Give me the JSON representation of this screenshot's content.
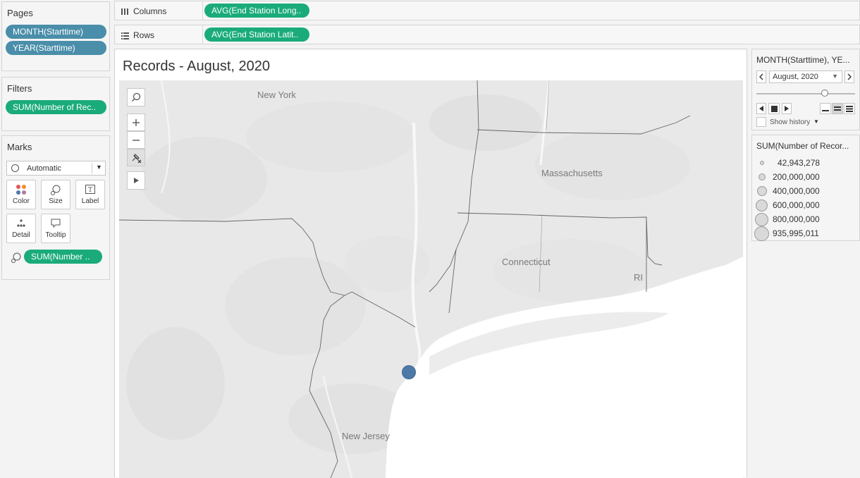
{
  "pages": {
    "title": "Pages",
    "pills": [
      "MONTH(Starttime)",
      "YEAR(Starttime)"
    ]
  },
  "filters": {
    "title": "Filters",
    "pills": [
      "SUM(Number of Rec.."
    ]
  },
  "marks": {
    "title": "Marks",
    "type": "Automatic",
    "buttons": {
      "color": "Color",
      "size": "Size",
      "label": "Label",
      "detail": "Detail",
      "tooltip": "Tooltip"
    },
    "size_pill": "SUM(Number .."
  },
  "shelves": {
    "columns_label": "Columns",
    "columns_pill": "AVG(End Station Long..",
    "rows_label": "Rows",
    "rows_pill": "AVG(End Station Latit.."
  },
  "view": {
    "title": "Records - August, 2020",
    "map_labels": {
      "new_york": "New York",
      "massachusetts": "Massachusetts",
      "connecticut": "Connecticut",
      "ri": "RI",
      "new_jersey": "New Jersey"
    },
    "mark_color": "#4e79a7"
  },
  "page_control": {
    "title": "MONTH(Starttime), YE...",
    "selected": "August, 2020",
    "show_history": "Show history"
  },
  "size_legend": {
    "title": "SUM(Number of Recor...",
    "items": [
      "42,943,278",
      "200,000,000",
      "400,000,000",
      "600,000,000",
      "800,000,000",
      "935,995,011"
    ]
  }
}
